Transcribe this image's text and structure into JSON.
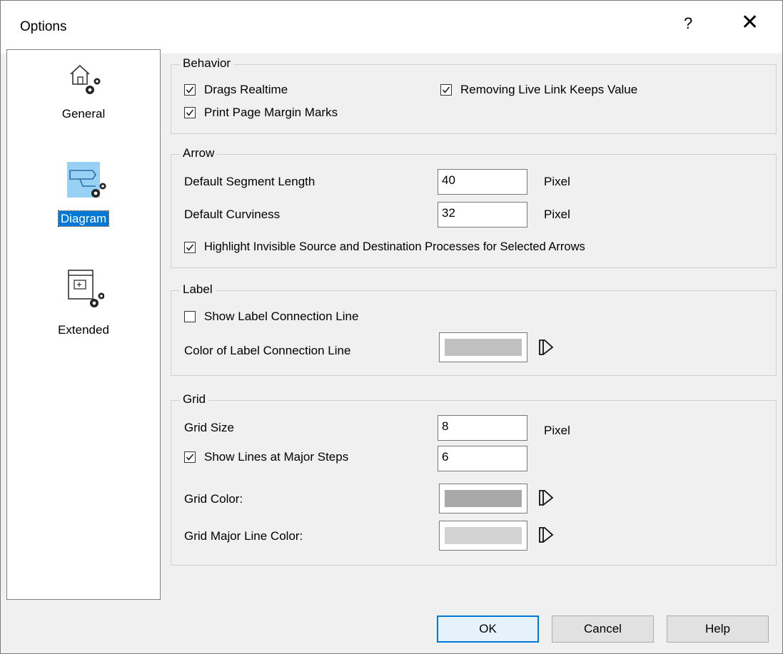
{
  "window": {
    "title": "Options",
    "help": "?",
    "close": "✕"
  },
  "sidebar": {
    "items": [
      {
        "label": "General"
      },
      {
        "label": "Diagram"
      },
      {
        "label": "Extended"
      }
    ]
  },
  "behavior": {
    "title": "Behavior",
    "drags_realtime": "Drags Realtime",
    "removing_live_link": "Removing Live Link Keeps Value",
    "print_page_margin": "Print Page Margin Marks"
  },
  "arrow": {
    "title": "Arrow",
    "segment_length_label": "Default Segment Length",
    "segment_length_value": "40",
    "segment_length_unit": "Pixel",
    "curviness_label": "Default Curviness",
    "curviness_value": "32",
    "curviness_unit": "Pixel",
    "highlight_label": "Highlight Invisible Source and Destination Processes for Selected Arrows"
  },
  "label": {
    "title": "Label",
    "show_connection_line": "Show Label Connection Line",
    "color_label": "Color of Label Connection Line",
    "color": "#c0c0c0"
  },
  "grid": {
    "title": "Grid",
    "size_label": "Grid Size",
    "size_value": "8",
    "size_unit": "Pixel",
    "major_steps_label": "Show Lines at Major Steps",
    "major_steps_value": "6",
    "color_label": "Grid Color:",
    "color": "#a9a9a9",
    "major_color_label": "Grid Major Line Color:",
    "major_color": "#d3d3d3"
  },
  "buttons": {
    "ok": "OK",
    "cancel": "Cancel",
    "help": "Help"
  },
  "colors": {
    "accent": "#0078d7",
    "selected_icon_bg": "#99d1f4"
  }
}
